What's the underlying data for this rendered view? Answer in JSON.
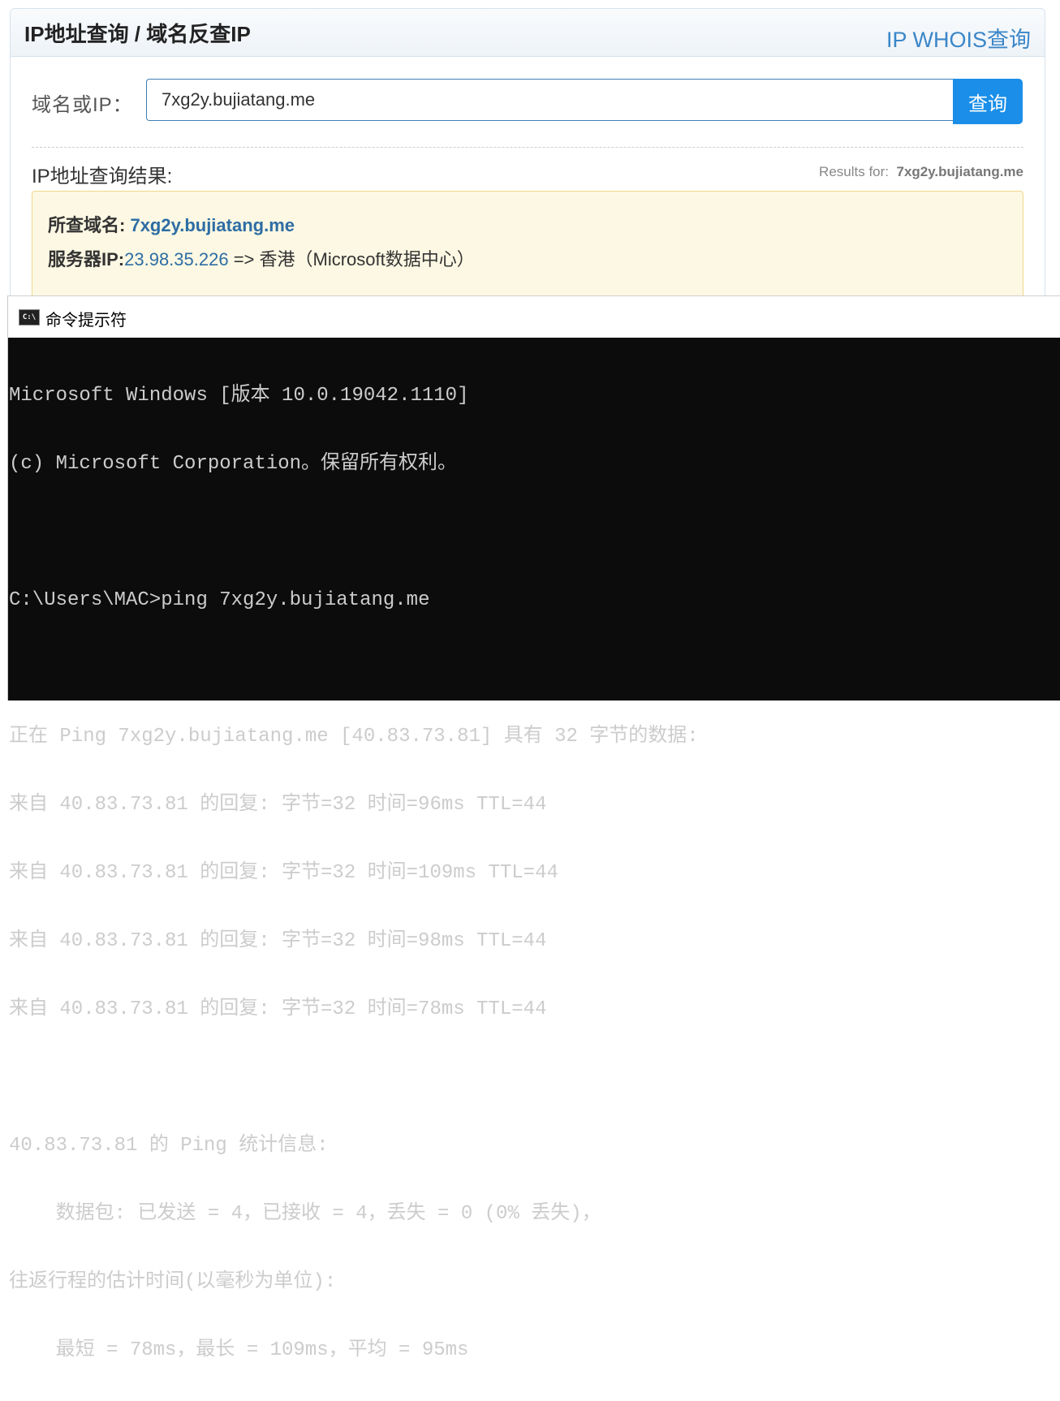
{
  "panel": {
    "title": "IP地址查询 / 域名反查IP",
    "whois_link": "IP WHOIS查询",
    "query_label": "域名或IP：",
    "query_value": "7xg2y.bujiatang.me",
    "query_button": "查询",
    "result_title": "IP地址查询结果:",
    "results_for_label": "Results for:",
    "results_for_value": "7xg2y.bujiatang.me",
    "domain_label": "所查域名:",
    "domain_value": "7xg2y.bujiatang.me",
    "server_ip_label": "服务器IP:",
    "server_ip_value": "23.98.35.226",
    "server_ip_location": " => 香港（Microsoft数据中心）"
  },
  "cmd": {
    "title": "命令提示符",
    "icon_text": "C:\\",
    "lines": [
      "Microsoft Windows [版本 10.0.19042.1110]",
      "(c) Microsoft Corporation。保留所有权利。",
      "",
      "C:\\Users\\MAC>ping 7xg2y.bujiatang.me",
      "",
      "正在 Ping 7xg2y.bujiatang.me [40.83.73.81] 具有 32 字节的数据:",
      "来自 40.83.73.81 的回复: 字节=32 时间=96ms TTL=44",
      "来自 40.83.73.81 的回复: 字节=32 时间=109ms TTL=44",
      "来自 40.83.73.81 的回复: 字节=32 时间=98ms TTL=44",
      "来自 40.83.73.81 的回复: 字节=32 时间=78ms TTL=44",
      "",
      "40.83.73.81 的 Ping 统计信息:",
      "    数据包: 已发送 = 4，已接收 = 4，丢失 = 0 (0% 丢失)，",
      "往返行程的估计时间(以毫秒为单位):",
      "    最短 = 78ms，最长 = 109ms，平均 = 95ms"
    ]
  }
}
